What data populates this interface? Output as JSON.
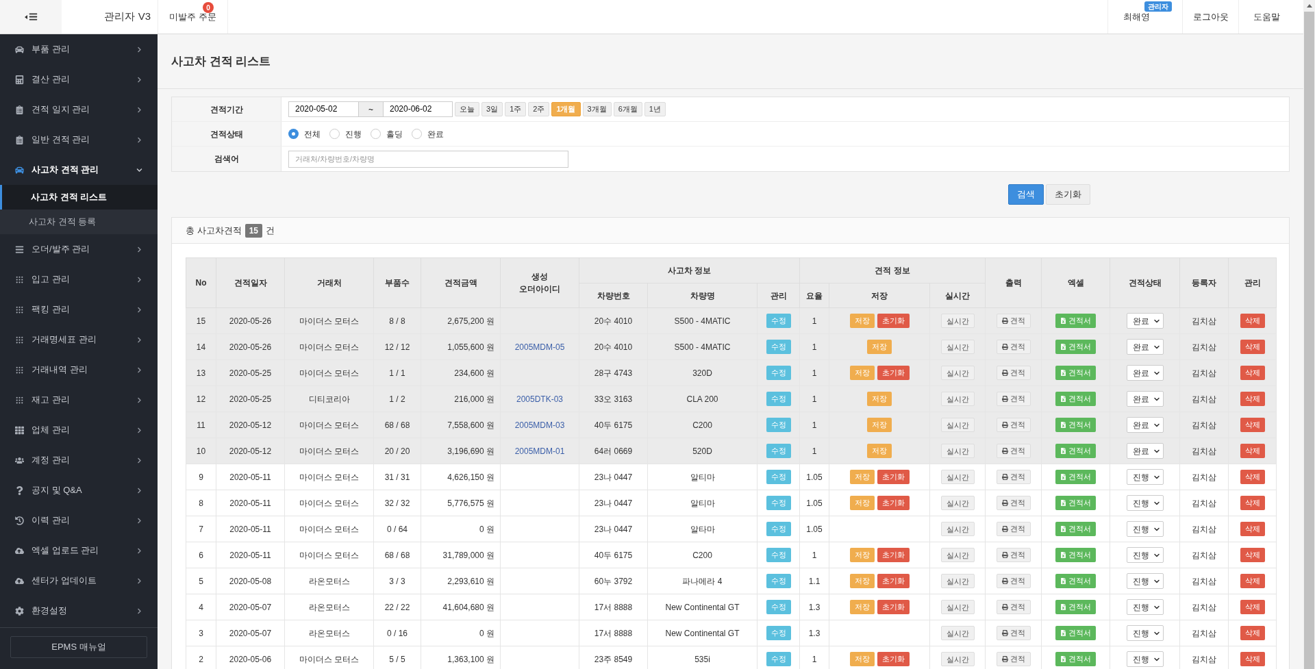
{
  "header": {
    "app_title": "관리자 V3",
    "nav_left": [
      {
        "label": "미발주 주문",
        "badge": "0"
      }
    ],
    "user": {
      "name": "최해영",
      "badge": "관리자"
    },
    "nav_right": [
      "로그아웃",
      "도움말"
    ]
  },
  "sidebar": {
    "items": [
      {
        "label": "부품 관리",
        "expanded": false
      },
      {
        "label": "결산 관리",
        "expanded": false
      },
      {
        "label": "견적 일지 관리",
        "expanded": false
      },
      {
        "label": "일반 견적 관리",
        "expanded": false
      },
      {
        "label": "사고차 견적 관리",
        "expanded": true,
        "children": [
          {
            "label": "사고차 견적 리스트",
            "selected": true
          },
          {
            "label": "사고차 견적 등록",
            "selected": false
          }
        ]
      },
      {
        "label": "오더/발주 관리",
        "expanded": false
      },
      {
        "label": "입고 관리",
        "expanded": false
      },
      {
        "label": "팩킹 관리",
        "expanded": false
      },
      {
        "label": "거래명세표 관리",
        "expanded": false
      },
      {
        "label": "거래내역 관리",
        "expanded": false
      },
      {
        "label": "재고 관리",
        "expanded": false
      },
      {
        "label": "업체 관리",
        "expanded": false
      },
      {
        "label": "계정 관리",
        "expanded": false
      },
      {
        "label": "공지 및 Q&A",
        "expanded": false
      },
      {
        "label": "이력 관리",
        "expanded": false
      },
      {
        "label": "엑셀 업로드 관리",
        "expanded": false
      },
      {
        "label": "센터가 업데이트",
        "expanded": false
      },
      {
        "label": "환경설정",
        "expanded": false
      }
    ],
    "manual_button": "EPMS 매뉴얼"
  },
  "page_title": "사고차 견적 리스트",
  "filter": {
    "period": {
      "label": "견적기간",
      "from": "2020-05-02",
      "separator": "~",
      "to": "2020-06-02",
      "quick": [
        {
          "label": "오늘",
          "selected": false
        },
        {
          "label": "3일",
          "selected": false
        },
        {
          "label": "1주",
          "selected": false
        },
        {
          "label": "2주",
          "selected": false
        },
        {
          "label": "1개월",
          "selected": true
        },
        {
          "label": "3개월",
          "selected": false
        },
        {
          "label": "6개월",
          "selected": false
        },
        {
          "label": "1년",
          "selected": false
        }
      ]
    },
    "status": {
      "label": "견적상태",
      "options": [
        {
          "label": "전체",
          "selected": true
        },
        {
          "label": "진행",
          "selected": false
        },
        {
          "label": "홀딩",
          "selected": false
        },
        {
          "label": "완료",
          "selected": false
        }
      ]
    },
    "keyword": {
      "label": "검색어",
      "placeholder": "거래처/차량번호/차량명"
    }
  },
  "actions": [
    "검색",
    "초기화"
  ],
  "summary": {
    "prefix": "총 사고차견적",
    "count": "15",
    "suffix": "건"
  },
  "table": {
    "group_headers": [
      "사고차 정보",
      "견적 정보"
    ],
    "columns": [
      "No",
      "견적일자",
      "거래처",
      "부품수",
      "견적금액",
      "생성\n오더아이디",
      "차량번호",
      "차량명",
      "관리",
      "요율",
      "저장",
      "실시간",
      "출력",
      "엑셀",
      "견적상태",
      "등록자",
      "관리"
    ],
    "rows": [
      {
        "no": "15",
        "date": "2020-05-26",
        "client": "마이더스 모터스",
        "parts": "8 / 8",
        "amount": "2,675,200 원",
        "car_no": "20수 4010",
        "car_name": "S500 - 4MATIC",
        "edit": "수정",
        "rate": "1",
        "save": "저장",
        "reset": "초기화",
        "realtime": "실시간",
        "print": "견적",
        "excel": "견적서",
        "status": "완료",
        "registrant": "김치삼",
        "delete": "삭제",
        "completed": true
      },
      {
        "no": "14",
        "date": "2020-05-26",
        "client": "마이더스 모터스",
        "parts": "12 / 12",
        "amount": "1,055,600 원",
        "order_id": "2005MDM-05",
        "car_no": "20수 4010",
        "car_name": "S500 - 4MATIC",
        "edit": "수정",
        "rate": "1",
        "save": "저장",
        "realtime": "실시간",
        "print": "견적",
        "excel": "견적서",
        "status": "완료",
        "registrant": "김치삼",
        "delete": "삭제",
        "completed": true
      },
      {
        "no": "13",
        "date": "2020-05-25",
        "client": "마이더스 모터스",
        "parts": "1 / 1",
        "amount": "234,600 원",
        "car_no": "28구 4743",
        "car_name": "320D",
        "edit": "수정",
        "rate": "1",
        "save": "저장",
        "reset": "초기화",
        "realtime": "실시간",
        "print": "견적",
        "excel": "견적서",
        "status": "완료",
        "registrant": "김치삼",
        "delete": "삭제",
        "completed": true
      },
      {
        "no": "12",
        "date": "2020-05-25",
        "client": "디티코리아",
        "parts": "1 / 2",
        "amount": "216,000 원",
        "order_id": "2005DTK-03",
        "car_no": "33오 3163",
        "car_name": "CLA 200",
        "edit": "수정",
        "rate": "1",
        "save": "저장",
        "realtime": "실시간",
        "print": "견적",
        "excel": "견적서",
        "status": "완료",
        "registrant": "김치삼",
        "delete": "삭제",
        "completed": true
      },
      {
        "no": "11",
        "date": "2020-05-12",
        "client": "마이더스 모터스",
        "parts": "68 / 68",
        "amount": "7,558,600 원",
        "order_id": "2005MDM-03",
        "car_no": "40두 6175",
        "car_name": "C200",
        "edit": "수정",
        "rate": "1",
        "save": "저장",
        "realtime": "실시간",
        "print": "견적",
        "excel": "견적서",
        "status": "완료",
        "registrant": "김치삼",
        "delete": "삭제",
        "completed": true
      },
      {
        "no": "10",
        "date": "2020-05-12",
        "client": "마이더스 모터스",
        "parts": "20 / 20",
        "amount": "3,196,690 원",
        "order_id": "2005MDM-01",
        "car_no": "64러 0669",
        "car_name": "520D",
        "edit": "수정",
        "rate": "1",
        "save": "저장",
        "realtime": "실시간",
        "print": "견적",
        "excel": "견적서",
        "status": "완료",
        "registrant": "김치삼",
        "delete": "삭제",
        "completed": true
      },
      {
        "no": "9",
        "date": "2020-05-11",
        "client": "마이더스 모터스",
        "parts": "31 / 31",
        "amount": "4,626,150 원",
        "car_no": "23나 0447",
        "car_name": "알티마",
        "edit": "수정",
        "rate": "1.05",
        "save": "저장",
        "reset": "초기화",
        "realtime": "실시간",
        "print": "견적",
        "excel": "견적서",
        "status": "진행",
        "registrant": "김치삼",
        "delete": "삭제",
        "completed": false
      },
      {
        "no": "8",
        "date": "2020-05-11",
        "client": "마이더스 모터스",
        "parts": "32 / 32",
        "amount": "5,776,575 원",
        "car_no": "23나 0447",
        "car_name": "알티마",
        "edit": "수정",
        "rate": "1.05",
        "save": "저장",
        "reset": "초기화",
        "realtime": "실시간",
        "print": "견적",
        "excel": "견적서",
        "status": "진행",
        "registrant": "김치삼",
        "delete": "삭제",
        "completed": false
      },
      {
        "no": "7",
        "date": "2020-05-11",
        "client": "마이더스 모터스",
        "parts": "0 / 64",
        "amount": "0 원",
        "car_no": "23나 0447",
        "car_name": "알타마",
        "edit": "수정",
        "rate": "1.05",
        "realtime": "실시간",
        "print": "견적",
        "excel": "견적서",
        "status": "진행",
        "registrant": "김치삼",
        "delete": "삭제",
        "completed": false
      },
      {
        "no": "6",
        "date": "2020-05-11",
        "client": "마이더스 모터스",
        "parts": "68 / 68",
        "amount": "31,789,000 원",
        "car_no": "40두 6175",
        "car_name": "C200",
        "edit": "수정",
        "rate": "1",
        "save": "저장",
        "reset": "초기화",
        "realtime": "실시간",
        "print": "견적",
        "excel": "견적서",
        "status": "진행",
        "registrant": "김치삼",
        "delete": "삭제",
        "completed": false
      },
      {
        "no": "5",
        "date": "2020-05-08",
        "client": "라온모터스",
        "parts": "3 / 3",
        "amount": "2,293,610 원",
        "car_no": "60누 3792",
        "car_name": "파나메라 4",
        "edit": "수정",
        "rate": "1.1",
        "save": "저장",
        "reset": "초기화",
        "realtime": "실시간",
        "print": "견적",
        "excel": "견적서",
        "status": "진행",
        "registrant": "김치삼",
        "delete": "삭제",
        "completed": false
      },
      {
        "no": "4",
        "date": "2020-05-07",
        "client": "라온모터스",
        "parts": "22 / 22",
        "amount": "41,604,680 원",
        "car_no": "17서 8888",
        "car_name": "New Continental GT",
        "edit": "수정",
        "rate": "1.3",
        "save": "저장",
        "reset": "초기화",
        "realtime": "실시간",
        "print": "견적",
        "excel": "견적서",
        "status": "진행",
        "registrant": "김치삼",
        "delete": "삭제",
        "completed": false
      },
      {
        "no": "3",
        "date": "2020-05-07",
        "client": "라온모터스",
        "parts": "0 / 16",
        "amount": "0 원",
        "car_no": "17서 8888",
        "car_name": "New Continental GT",
        "edit": "수정",
        "rate": "1.3",
        "realtime": "실시간",
        "print": "견적",
        "excel": "견적서",
        "status": "진행",
        "registrant": "김치삼",
        "delete": "삭제",
        "completed": false
      },
      {
        "no": "2",
        "date": "2020-05-06",
        "client": "마이더스 모터스",
        "parts": "5 / 5",
        "amount": "1,363,100 원",
        "car_no": "23주 8549",
        "car_name": "535i",
        "edit": "수정",
        "rate": "1",
        "save": "저장",
        "reset": "초기화",
        "realtime": "실시간",
        "print": "견적",
        "excel": "견적서",
        "status": "진행",
        "registrant": "김치삼",
        "delete": "삭제",
        "completed": false
      }
    ]
  }
}
